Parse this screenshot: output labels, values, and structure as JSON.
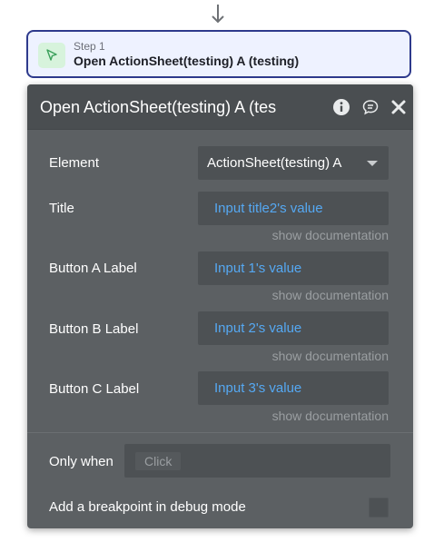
{
  "step": {
    "label": "Step 1",
    "title": "Open ActionSheet(testing) A (testing)"
  },
  "panel": {
    "title": "Open ActionSheet(testing) A (tes",
    "element": {
      "label": "Element",
      "value": "ActionSheet(testing) A"
    },
    "fields": [
      {
        "label": "Title",
        "value": "Input title2's value",
        "doc_link": "show documentation"
      },
      {
        "label": "Button A Label",
        "value": "Input 1's value",
        "doc_link": "show documentation"
      },
      {
        "label": "Button B Label",
        "value": "Input 2's value",
        "doc_link": "show documentation"
      },
      {
        "label": "Button C Label",
        "value": "Input 3's value",
        "doc_link": "show documentation"
      }
    ],
    "only_when": {
      "label": "Only when",
      "placeholder": "Click"
    },
    "breakpoint": {
      "label": "Add a breakpoint in debug mode",
      "checked": false
    }
  },
  "icons": {
    "connector": "arrow-down-icon",
    "step": "cursor-pointer-icon",
    "info": "info-icon",
    "comment": "comment-icon",
    "close": "close-icon"
  },
  "colors": {
    "step_border": "#2e3a8c",
    "step_bg": "#eef2ff",
    "panel_bg": "#5c6063",
    "header_bg": "#4a4e51",
    "field_bg": "#4d5154",
    "dynamic_value": "#55a8f2",
    "doc_link": "#9a9ea1"
  }
}
